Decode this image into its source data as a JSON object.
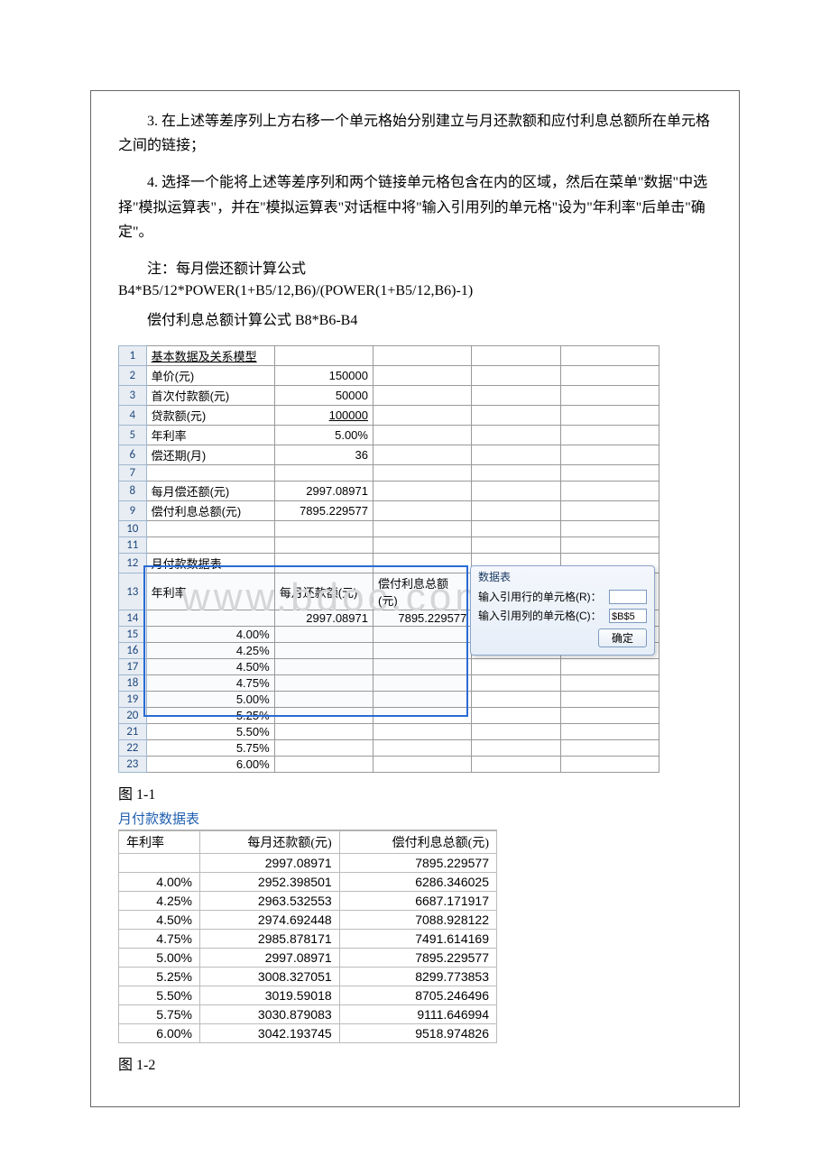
{
  "body": {
    "p1": "3. 在上述等差序列上方右移一个单元格始分别建立与月还款额和应付利息总额所在单元格之间的链接；",
    "p2": "4. 选择一个能将上述等差序列和两个链接单元格包含在内的区域，然后在菜单\"数据\"中选择\"模拟运算表\"，并在\"模拟运算表\"对话框中将\"输入引用列的单元格\"设为\"年利率\"后单击\"确定\"。",
    "p3": "注：每月偿还额计算公式",
    "formula1": "B4*B5/12*POWER(1+B5/12,B6)/(POWER(1+B5/12,B6)-1)",
    "p4": "偿付利息总额计算公式 B8*B6-B4",
    "fig1": "图 1-1",
    "fig2": "图 1-2"
  },
  "ss1": {
    "watermark": "www.bdoc.com",
    "rows": [
      {
        "n": "1",
        "a": "基本数据及关系模型",
        "a_u": true
      },
      {
        "n": "2",
        "a": "单价(元)",
        "b": "150000"
      },
      {
        "n": "3",
        "a": "首次付款额(元)",
        "b": "50000"
      },
      {
        "n": "4",
        "a": "贷款额(元)",
        "b": "100000",
        "b_u": true
      },
      {
        "n": "5",
        "a": "年利率",
        "b": "5.00%",
        "b_marquee": true
      },
      {
        "n": "6",
        "a": "偿还期(月)",
        "b": "36"
      },
      {
        "n": "7"
      },
      {
        "n": "8",
        "a": "每月偿还额(元)",
        "b": "2997.08971"
      },
      {
        "n": "9",
        "a": "偿付利息总额(元)",
        "b": "7895.229577"
      },
      {
        "n": "10"
      },
      {
        "n": "11"
      },
      {
        "n": "12",
        "a": "月付款数据表"
      },
      {
        "n": "13",
        "a": "年利率",
        "b": "每月还款额(元)",
        "c": "偿付利息总额(元)",
        "b_left": true,
        "c_left": true
      },
      {
        "n": "14",
        "b": "2997.08971",
        "c": "7895.229577"
      },
      {
        "n": "15",
        "a": "4.00%",
        "a_right": true
      },
      {
        "n": "16",
        "a": "4.25%",
        "a_right": true
      },
      {
        "n": "17",
        "a": "4.50%",
        "a_right": true
      },
      {
        "n": "18",
        "a": "4.75%",
        "a_right": true
      },
      {
        "n": "19",
        "a": "5.00%",
        "a_right": true
      },
      {
        "n": "20",
        "a": "5.25%",
        "a_right": true
      },
      {
        "n": "21",
        "a": "5.50%",
        "a_right": true
      },
      {
        "n": "22",
        "a": "5.75%",
        "a_right": true
      },
      {
        "n": "23",
        "a": "6.00%",
        "a_right": true
      }
    ],
    "dialog": {
      "title": "数据表",
      "rowLabel": "输入引用行的单元格(R)：",
      "colLabel": "输入引用列的单元格(C)：",
      "colValue": "$B$5",
      "ok": "确定"
    }
  },
  "results": {
    "title": "月付款数据表",
    "headers": [
      "年利率",
      "每月还款额(元)",
      "偿付利息总额(元)"
    ],
    "rows": [
      [
        "",
        "2997.08971",
        "7895.229577"
      ],
      [
        "4.00%",
        "2952.398501",
        "6286.346025"
      ],
      [
        "4.25%",
        "2963.532553",
        "6687.171917"
      ],
      [
        "4.50%",
        "2974.692448",
        "7088.928122"
      ],
      [
        "4.75%",
        "2985.878171",
        "7491.614169"
      ],
      [
        "5.00%",
        "2997.08971",
        "7895.229577"
      ],
      [
        "5.25%",
        "3008.327051",
        "8299.773853"
      ],
      [
        "5.50%",
        "3019.59018",
        "8705.246496"
      ],
      [
        "5.75%",
        "3030.879083",
        "9111.646994"
      ],
      [
        "6.00%",
        "3042.193745",
        "9518.974826"
      ]
    ]
  },
  "chart_data": {
    "type": "table",
    "title": "月付款数据表",
    "columns": [
      "年利率",
      "每月还款额(元)",
      "偿付利息总额(元)"
    ],
    "rows": [
      [
        null,
        2997.08971,
        7895.229577
      ],
      [
        0.04,
        2952.398501,
        6286.346025
      ],
      [
        0.0425,
        2963.532553,
        6687.171917
      ],
      [
        0.045,
        2974.692448,
        7088.928122
      ],
      [
        0.0475,
        2985.878171,
        7491.614169
      ],
      [
        0.05,
        2997.08971,
        7895.229577
      ],
      [
        0.0525,
        3008.327051,
        8299.773853
      ],
      [
        0.055,
        3019.59018,
        8705.246496
      ],
      [
        0.0575,
        3030.879083,
        9111.646994
      ],
      [
        0.06,
        3042.193745,
        9518.974826
      ]
    ]
  }
}
